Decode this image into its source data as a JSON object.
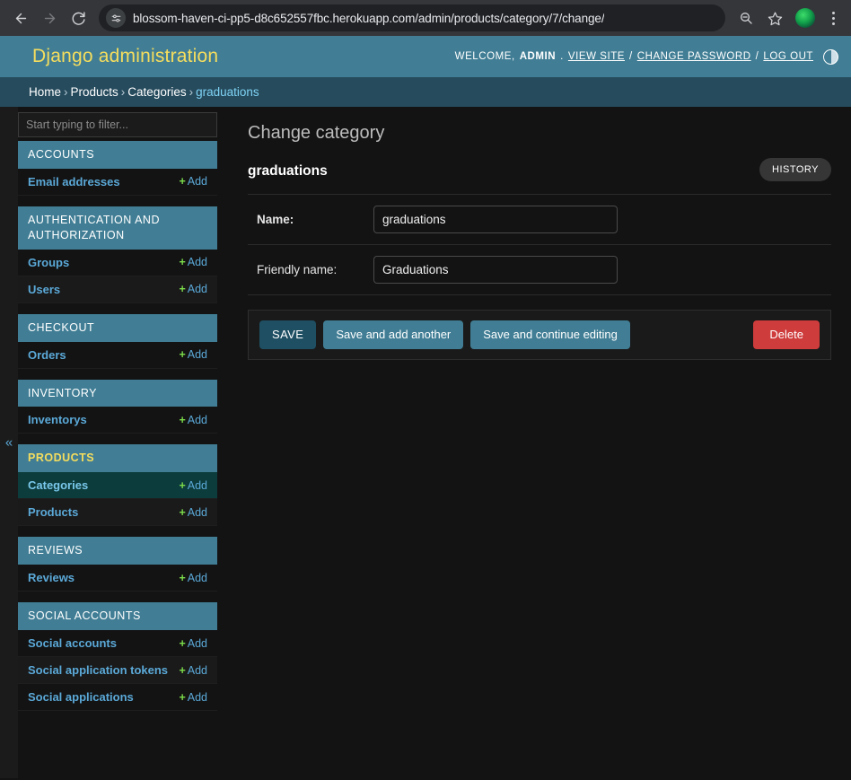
{
  "browser": {
    "back_icon": "back-arrow-icon",
    "forward_icon": "forward-arrow-icon",
    "reload_icon": "reload-icon",
    "site_settings_icon": "tune-sliders-icon",
    "url": "blossom-haven-ci-pp5-d8c652557fbc.herokuapp.com/admin/products/category/7/change/",
    "zoom_out_icon": "zoom-out-magnifier-icon",
    "bookmark_icon": "star-icon",
    "profile_icon": "profile-avatar-icon",
    "menu_icon": "three-dot-menu-icon"
  },
  "header": {
    "branding": "Django administration",
    "welcome_prefix": "WELCOME,",
    "username": "ADMIN",
    "username_suffix": ".",
    "view_site": "VIEW SITE",
    "change_password": "CHANGE PASSWORD",
    "log_out": "LOG OUT",
    "separator": "/",
    "theme_toggle_icon": "theme-toggle-icon"
  },
  "breadcrumbs": {
    "home": "Home",
    "app": "Products",
    "model": "Categories",
    "current": "graduations",
    "separator": "›"
  },
  "sidebar": {
    "toggle_icon": "collapse-chevron-left-icon",
    "filter_placeholder": "Start typing to filter...",
    "filter_value": "",
    "add_label": "Add",
    "add_plus": "+",
    "apps": [
      {
        "title": "ACCOUNTS",
        "current": false,
        "models": [
          {
            "name": "Email addresses",
            "current": false
          }
        ]
      },
      {
        "title": "AUTHENTICATION AND AUTHORIZATION",
        "current": false,
        "models": [
          {
            "name": "Groups",
            "current": false
          },
          {
            "name": "Users",
            "current": false
          }
        ]
      },
      {
        "title": "CHECKOUT",
        "current": false,
        "models": [
          {
            "name": "Orders",
            "current": false
          }
        ]
      },
      {
        "title": "INVENTORY",
        "current": false,
        "models": [
          {
            "name": "Inventorys",
            "current": false
          }
        ]
      },
      {
        "title": "PRODUCTS",
        "current": true,
        "models": [
          {
            "name": "Categories",
            "current": true
          },
          {
            "name": "Products",
            "current": false
          }
        ]
      },
      {
        "title": "REVIEWS",
        "current": false,
        "models": [
          {
            "name": "Reviews",
            "current": false
          }
        ]
      },
      {
        "title": "SOCIAL ACCOUNTS",
        "current": false,
        "models": [
          {
            "name": "Social accounts",
            "current": false
          },
          {
            "name": "Social application tokens",
            "current": false
          },
          {
            "name": "Social applications",
            "current": false
          }
        ]
      }
    ]
  },
  "main": {
    "title": "Change category",
    "history_label": "HISTORY",
    "object_name": "graduations",
    "fields": [
      {
        "label": "Name:",
        "value": "graduations",
        "required": true
      },
      {
        "label": "Friendly name:",
        "value": "Graduations",
        "required": false
      }
    ],
    "buttons": {
      "save": "SAVE",
      "save_and_add_another": "Save and add another",
      "save_and_continue": "Save and continue editing",
      "delete": "Delete"
    }
  },
  "colors": {
    "header_teal": "#417e95",
    "breadcrumb_teal": "#264b5d",
    "branding_yellow": "#f5dd5d",
    "link_blue": "#5ba9d8",
    "add_green": "#7ddc4b",
    "current_model_bg": "#0c3c3c",
    "save_button": "#1f4f63",
    "delete_red": "#cf3c3c",
    "page_bg": "#131313"
  }
}
